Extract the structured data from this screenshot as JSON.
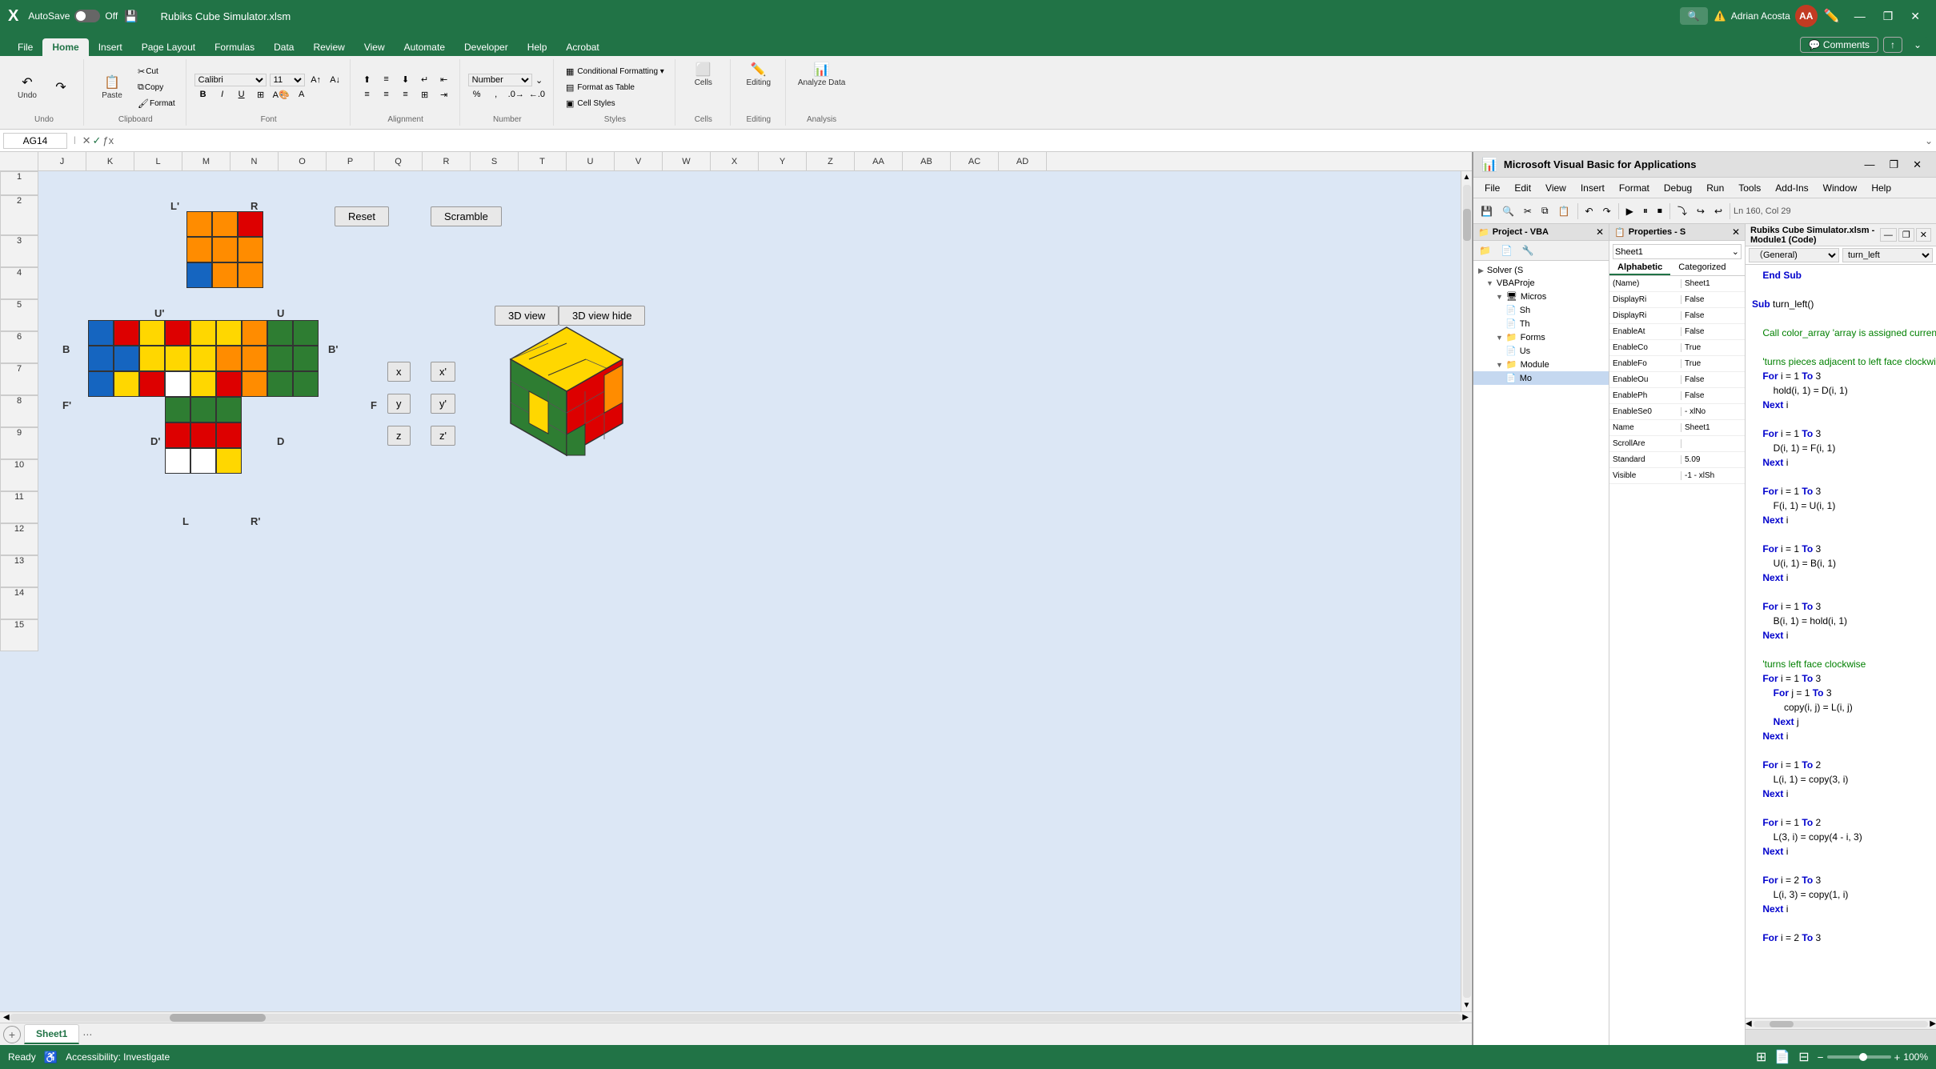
{
  "app": {
    "title": "Rubiks Cube Simulator.xlsm",
    "excel_icon": "X",
    "autosave_label": "AutoSave",
    "autosave_state": "Off"
  },
  "ribbon_tabs": [
    {
      "id": "file",
      "label": "File"
    },
    {
      "id": "home",
      "label": "Home",
      "active": true
    },
    {
      "id": "insert",
      "label": "Insert"
    },
    {
      "id": "page_layout",
      "label": "Page Layout"
    },
    {
      "id": "formulas",
      "label": "Formulas"
    },
    {
      "id": "data",
      "label": "Data"
    },
    {
      "id": "review",
      "label": "Review"
    },
    {
      "id": "view",
      "label": "View"
    },
    {
      "id": "automate",
      "label": "Automate"
    },
    {
      "id": "developer",
      "label": "Developer"
    },
    {
      "id": "help",
      "label": "Help"
    },
    {
      "id": "acrobat",
      "label": "Acrobat"
    }
  ],
  "ribbon_groups": {
    "undo": {
      "label": "Undo"
    },
    "clipboard": {
      "label": "Clipboard"
    },
    "font": {
      "label": "Font"
    },
    "alignment": {
      "label": "Alignment"
    },
    "number": {
      "label": "Number"
    },
    "styles": {
      "label": "Styles",
      "conditional_formatting": "Conditional Formatting",
      "format_as_table": "Format as Table",
      "cell_styles": "Cell Styles"
    },
    "cells": {
      "label": "Cells"
    },
    "editing": {
      "label": "Editing"
    },
    "analysis": {
      "label": "Analysis"
    }
  },
  "formula_bar": {
    "cell_ref": "AG14",
    "formula_content": ""
  },
  "columns": [
    "J",
    "K",
    "L",
    "M",
    "N",
    "O",
    "P",
    "Q",
    "R",
    "S",
    "T",
    "U",
    "V",
    "W",
    "X",
    "Y",
    "Z",
    "AA",
    "AB",
    "AC",
    "AD"
  ],
  "rows": [
    1,
    2,
    3,
    4,
    5,
    6,
    7,
    8,
    9,
    10,
    11,
    12,
    13,
    14,
    15
  ],
  "buttons": [
    {
      "id": "reset",
      "label": "Reset"
    },
    {
      "id": "scramble",
      "label": "Scramble"
    },
    {
      "id": "3d_view",
      "label": "3D view"
    },
    {
      "id": "3d_view_hide",
      "label": "3D view hide"
    },
    {
      "id": "x",
      "label": "x"
    },
    {
      "id": "x_prime",
      "label": "x'"
    },
    {
      "id": "y",
      "label": "y"
    },
    {
      "id": "y_prime",
      "label": "y'"
    },
    {
      "id": "z",
      "label": "z"
    },
    {
      "id": "z_prime",
      "label": "z'"
    }
  ],
  "cube_labels": {
    "L_prime": "L'",
    "R": "R",
    "U_prime": "U'",
    "U": "U",
    "B": "B",
    "B_prime": "B'",
    "F_prime": "F'",
    "F": "F",
    "D_prime": "D'",
    "D": "D",
    "L": "L",
    "R_prime": "R'"
  },
  "sheet_tabs": [
    {
      "id": "sheet1",
      "label": "Sheet1",
      "active": true
    }
  ],
  "status_bar": {
    "ready": "Ready",
    "accessibility": "Accessibility: Investigate",
    "view_modes": [
      "Normal",
      "Page Layout",
      "Page Break Preview"
    ],
    "zoom": "100%"
  },
  "vba": {
    "title": "Microsoft Visual Basic for Applications",
    "menu": [
      "File",
      "Edit",
      "View",
      "Insert",
      "Format",
      "Debug",
      "Run",
      "Tools",
      "Add-Ins",
      "Window",
      "Help"
    ],
    "toolbar_position": "Ln 160, Col 29",
    "project_title": "Project - VBA",
    "code_title": "Rubiks Cube Simulator.xlsm - Module1 (Code)",
    "module_selector": "(General)",
    "proc_selector": "turn_left",
    "project_tree": [
      {
        "label": "Solver (S",
        "indent": 0,
        "type": "folder"
      },
      {
        "label": "VBAProje",
        "indent": 1,
        "type": "folder"
      },
      {
        "label": "Micros",
        "indent": 2,
        "type": "folder"
      },
      {
        "label": "Sh",
        "indent": 3,
        "type": "item"
      },
      {
        "label": "Th",
        "indent": 3,
        "type": "item"
      },
      {
        "label": "Forms",
        "indent": 2,
        "type": "folder"
      },
      {
        "label": "Us",
        "indent": 3,
        "type": "item"
      },
      {
        "label": "Module",
        "indent": 2,
        "type": "folder"
      },
      {
        "label": "Mo",
        "indent": 3,
        "type": "item",
        "selected": true
      }
    ],
    "properties_title": "Properties - S",
    "properties_dropdown": "Sheet1",
    "properties_tab_alphabetic": "Alphabetic",
    "properties_tab_categorized": "Categorized",
    "properties": [
      {
        "key": "(Name)",
        "value": "Sheet1"
      },
      {
        "key": "DisplayRi",
        "value": "False"
      },
      {
        "key": "DisplayRi",
        "value": "False"
      },
      {
        "key": "EnableAt",
        "value": "False"
      },
      {
        "key": "EnableCo",
        "value": "True"
      },
      {
        "key": "EnableFo",
        "value": "True"
      },
      {
        "key": "EnableOu",
        "value": "False"
      },
      {
        "key": "EnablePh",
        "value": "False"
      },
      {
        "key": "EnableSe0",
        "value": "- xlNo"
      },
      {
        "key": "Name",
        "value": "Sheet1"
      },
      {
        "key": "ScrollAre",
        "value": ""
      },
      {
        "key": "Standard",
        "value": "5.09"
      },
      {
        "key": "Visible",
        "value": "-1 - xlSh"
      }
    ],
    "code_lines": [
      {
        "type": "normal",
        "text": "    End Sub"
      },
      {
        "type": "blank",
        "text": ""
      },
      {
        "type": "sub",
        "text": "Sub turn_left()"
      },
      {
        "type": "blank",
        "text": ""
      },
      {
        "type": "comment",
        "text": "    Call color_array 'array is assigned current colors"
      },
      {
        "type": "blank",
        "text": ""
      },
      {
        "type": "comment",
        "text": "    'turns pieces adjacent to left face clockwise"
      },
      {
        "type": "normal",
        "text": "    For i = 1 To 3"
      },
      {
        "type": "normal",
        "text": "        hold(i, 1) = D(i, 1)"
      },
      {
        "type": "normal",
        "text": "    Next i"
      },
      {
        "type": "blank",
        "text": ""
      },
      {
        "type": "normal",
        "text": "    For i = 1 To 3"
      },
      {
        "type": "normal",
        "text": "        D(i, 1) = F(i, 1)"
      },
      {
        "type": "normal",
        "text": "    Next i"
      },
      {
        "type": "blank",
        "text": ""
      },
      {
        "type": "normal",
        "text": "    For i = 1 To 3"
      },
      {
        "type": "normal",
        "text": "        F(i, 1) = U(i, 1)"
      },
      {
        "type": "normal",
        "text": "    Next i"
      },
      {
        "type": "blank",
        "text": ""
      },
      {
        "type": "normal",
        "text": "    For i = 1 To 3"
      },
      {
        "type": "normal",
        "text": "        U(i, 1) = B(i, 1)"
      },
      {
        "type": "normal",
        "text": "    Next i"
      },
      {
        "type": "blank",
        "text": ""
      },
      {
        "type": "normal",
        "text": "    For i = 1 To 3"
      },
      {
        "type": "normal",
        "text": "        B(i, 1) = hold(i, 1)"
      },
      {
        "type": "normal",
        "text": "    Next i"
      },
      {
        "type": "blank",
        "text": ""
      },
      {
        "type": "comment",
        "text": "    'turns left face clockwise"
      },
      {
        "type": "normal",
        "text": "    For i = 1 To 3"
      },
      {
        "type": "normal",
        "text": "        For j = 1 To 3"
      },
      {
        "type": "normal",
        "text": "            copy(i, j) = L(i, j)"
      },
      {
        "type": "normal",
        "text": "        Next j"
      },
      {
        "type": "normal",
        "text": "    Next i"
      },
      {
        "type": "blank",
        "text": ""
      },
      {
        "type": "normal",
        "text": "    For i = 1 To 2"
      },
      {
        "type": "normal",
        "text": "        L(i, 1) = copy(3, i)"
      },
      {
        "type": "normal",
        "text": "    Next i"
      },
      {
        "type": "blank",
        "text": ""
      },
      {
        "type": "normal",
        "text": "    For i = 1 To 2"
      },
      {
        "type": "normal",
        "text": "        L(3, i) = copy(4 - i, 3)"
      },
      {
        "type": "normal",
        "text": "    Next i"
      },
      {
        "type": "blank",
        "text": ""
      },
      {
        "type": "normal",
        "text": "    For i = 2 To 3"
      },
      {
        "type": "normal",
        "text": "        L(i, 3) = copy(1, i)"
      },
      {
        "type": "normal",
        "text": "    Next i"
      },
      {
        "type": "blank",
        "text": ""
      },
      {
        "type": "normal",
        "text": "    For i = 2 To 3"
      }
    ]
  },
  "cube_faces": {
    "top_row": {
      "label_left": "L'",
      "label_right": "R",
      "face": [
        [
          "orange",
          "orange",
          "red"
        ],
        [
          "orange",
          "orange",
          "orange"
        ],
        [
          "blue",
          "orange",
          "orange"
        ]
      ]
    },
    "middle_row": {
      "label_u_prime": "U'",
      "label_u": "U",
      "label_b": "B",
      "label_b_prime": "B'",
      "label_f_prime": "F'",
      "label_f": "F",
      "left_face": [
        [
          "blue",
          "red",
          "yellow"
        ],
        [
          "blue",
          "blue",
          "yellow"
        ],
        [
          "blue",
          "yellow",
          "red"
        ]
      ],
      "front_face": [
        [
          "red",
          "yellow",
          "yellow"
        ],
        [
          "yellow",
          "yellow",
          "orange"
        ],
        [
          "white",
          "yellow",
          "red"
        ]
      ],
      "right_face": [
        [
          "orange",
          "green",
          "green"
        ],
        [
          "orange",
          "green",
          "green"
        ],
        [
          "orange",
          "green",
          "green"
        ]
      ]
    },
    "bottom_row": {
      "label_d_prime": "D'",
      "label_d": "D",
      "label_l": "L",
      "label_r_prime": "R'",
      "bottom_face": [
        [
          "green",
          "green",
          "green"
        ],
        [
          "red",
          "red",
          "red"
        ],
        [
          "white",
          "white",
          "yellow"
        ]
      ]
    }
  }
}
